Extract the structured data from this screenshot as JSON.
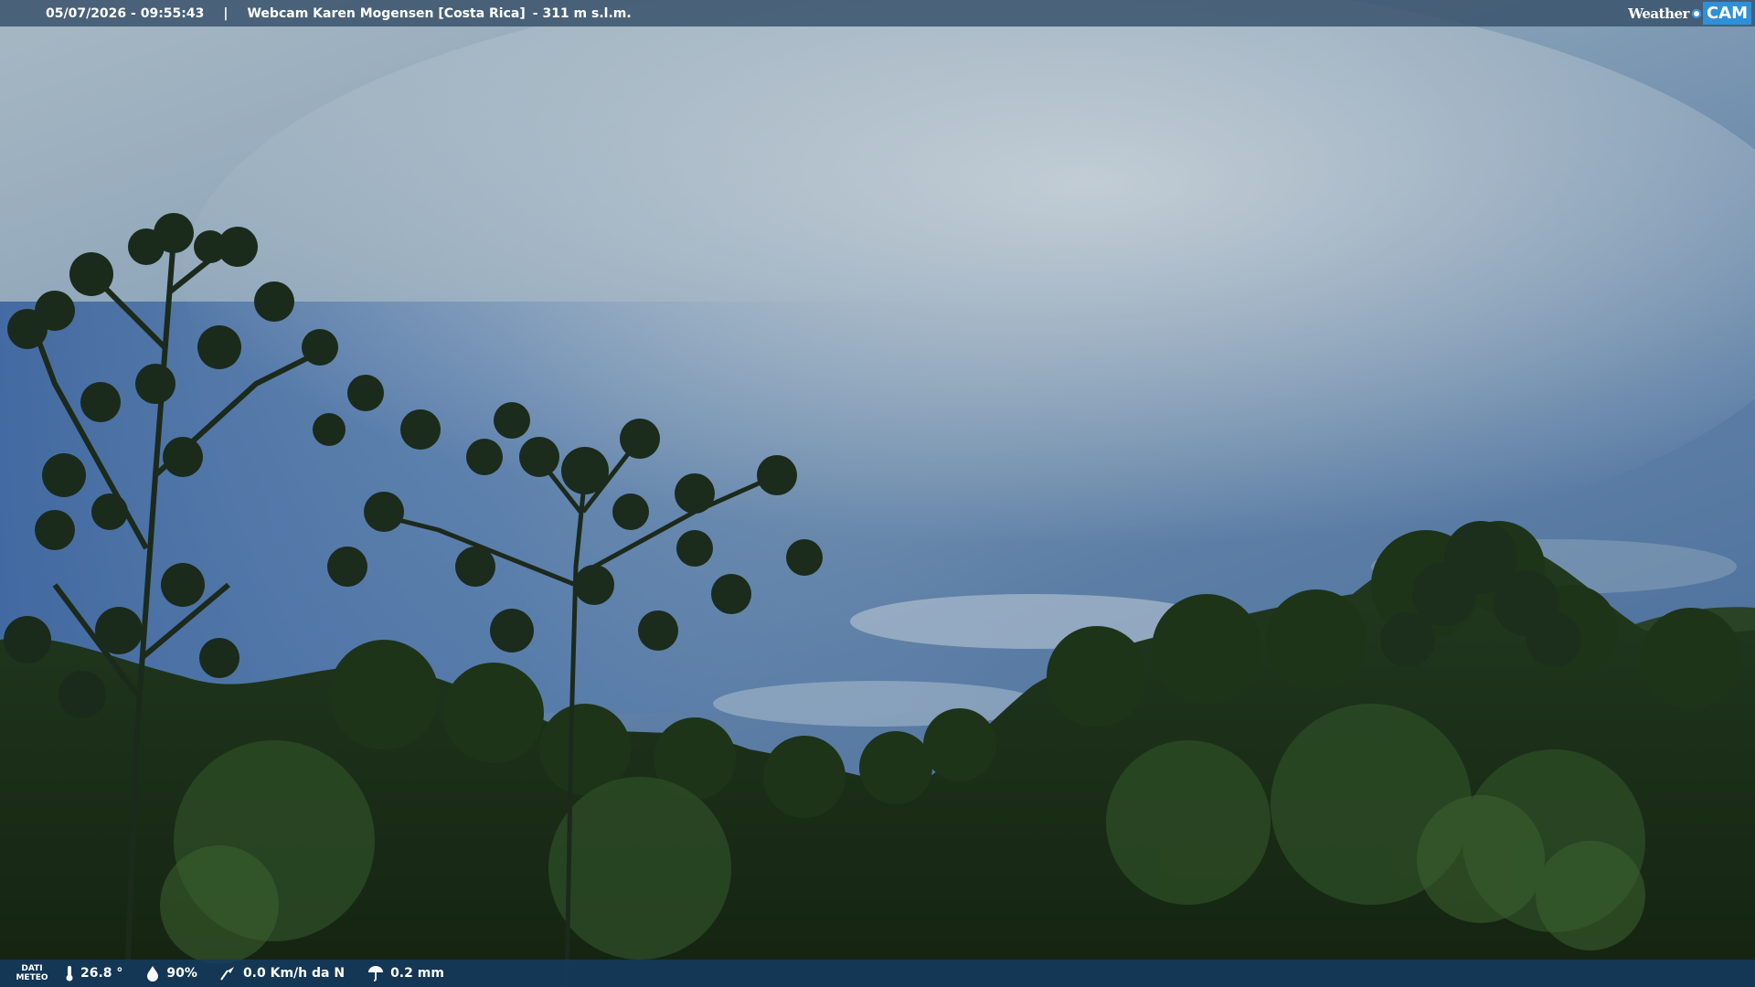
{
  "header": {
    "datetime": "05/07/2026 - 09:55:43",
    "separator": "|",
    "title": "Webcam Karen Mogensen [Costa Rica]",
    "altitude": "- 311 m s.l.m."
  },
  "brand": {
    "weather_text": "Weather",
    "cam_text": "CAM",
    "accent_color": "#2f8fd8"
  },
  "footer": {
    "dati_label_1": "DATI",
    "dati_label_2": "METEO",
    "temperature": "26.8 °",
    "humidity": "90%",
    "wind": "0.0 Km/h da N",
    "rain": "0.2 mm"
  },
  "icons": {
    "temperature": "thermometer-icon",
    "humidity": "humidity-icon",
    "wind": "wind-icon",
    "rain": "rain-icon"
  }
}
